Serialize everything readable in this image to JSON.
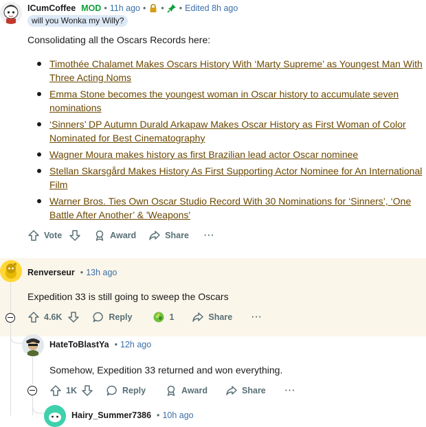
{
  "post": {
    "username": "ICumCoffee",
    "mod_badge": "MOD",
    "time": "11h ago",
    "edited": "Edited 8h ago",
    "flair": "will you Wonka my Willy?",
    "intro": "Consolidating all the Oscars Records here:",
    "links": [
      "Timothée Chalamet Makes Oscars History With ‘Marty Supreme’ as Youngest Man With Three Acting Noms",
      "Emma Stone becomes the youngest woman in Oscar history to accumulate seven nominations",
      "‘Sinners’ DP Autumn Durald Arkapaw Makes Oscar History as First Woman of Color Nominated for Best Cinematography",
      "Wagner Moura makes history as first Brazilian lead actor Oscar nominee",
      "Stellan Skarsgård Makes History As First Supporting Actor Nominee for An International Film",
      "Warner Bros. Ties Own Oscar Studio Record With 30 Nominations for ‘Sinners’, ‘One Battle After Another’ & 'Weapons'"
    ],
    "actions": {
      "vote": "Vote",
      "award": "Award",
      "share": "Share",
      "more": "···"
    }
  },
  "comment1": {
    "username": "Renverseur",
    "time": "13h ago",
    "text": "Expedition 33 is still going to sweep the Oscars",
    "score": "4.6K",
    "reply": "Reply",
    "award_count": "1",
    "share": "Share",
    "more": "···"
  },
  "comment2": {
    "username": "HateToBlastYa",
    "time": "12h ago",
    "text": "Somehow, Expedition 33 returned and won everything.",
    "score": "1K",
    "reply": "Reply",
    "award": "Award",
    "share": "Share",
    "more": "···"
  },
  "comment3": {
    "username": "Hairy_Summer7386",
    "time": "10h ago"
  },
  "colors": {
    "link": "#6b4700",
    "mod": "#0e9f3a",
    "time": "#3b6fa8",
    "highlight": "#fbf6ea"
  }
}
